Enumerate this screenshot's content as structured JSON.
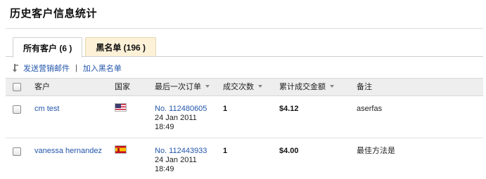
{
  "page": {
    "title": "历史客户信息统计"
  },
  "tabs": [
    {
      "label": "所有客户 (6 )",
      "active": true
    },
    {
      "label": "黑名单 (196 )",
      "active": false
    }
  ],
  "actions": {
    "send_email": "发送营销邮件",
    "separator": "|",
    "add_blacklist": "加入黑名单"
  },
  "table": {
    "headers": {
      "customer": "客户",
      "country": "国家",
      "last_order": "最后一次订单",
      "deal_count": "成交次数",
      "total_amount": "累计成交金额",
      "remark": "备注"
    },
    "rows": [
      {
        "customer": "cm test",
        "country_flag": "us-flag-icon",
        "order_no": "No. 112480605",
        "order_date": "24 Jan 2011",
        "order_time": "18:49",
        "deal_count": "1",
        "total_amount": "$4.12",
        "remark": "aserfas"
      },
      {
        "customer": "vanessa hernandez",
        "country_flag": "es-flag-icon",
        "order_no": "No. 112443933",
        "order_date": "24 Jan 2011",
        "order_time": "18:49",
        "deal_count": "1",
        "total_amount": "$4.00",
        "remark": "最佳方法是"
      }
    ]
  },
  "colors": {
    "link": "#2255aa",
    "tab_inactive_bg": "#fdf1d8",
    "header_bg": "#eeeeee"
  }
}
